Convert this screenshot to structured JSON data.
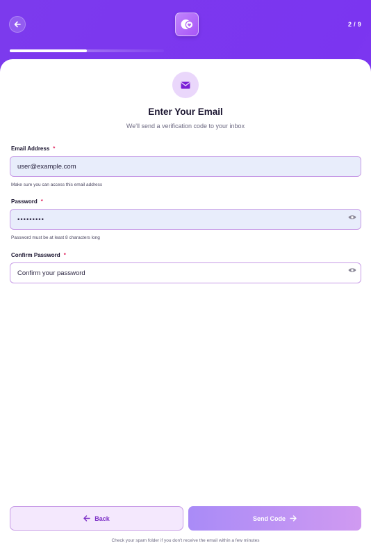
{
  "header": {
    "step_counter": "2 / 9",
    "progress_fraction": 0.5
  },
  "main": {
    "icon": "envelope-icon",
    "title": "Enter Your Email",
    "subtitle": "We'll send a verification code to your inbox"
  },
  "fields": {
    "email": {
      "label": "Email Address",
      "required_mark": "*",
      "value": "user@example.com",
      "hint": "Make sure you can access this email address"
    },
    "password": {
      "label": "Password",
      "required_mark": "*",
      "value": "•••••••••",
      "hint": "Password must be at least 8 characters long"
    },
    "confirm_password": {
      "label": "Confirm Password",
      "required_mark": "*",
      "value": "",
      "placeholder": "Confirm your password"
    }
  },
  "actions": {
    "back_label": "Back",
    "send_label": "Send Code"
  },
  "footer": {
    "note": "Check your spam folder if you don't receive the email within a few minutes"
  },
  "colors": {
    "header_gradient_start": "#7c3aed",
    "accent": "#c79be6",
    "required": "#e0245e"
  }
}
